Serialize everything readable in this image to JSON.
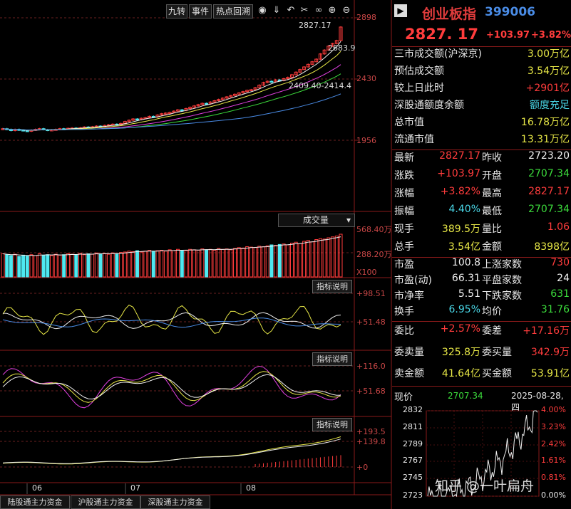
{
  "toolbar": {
    "buttons": [
      "九转",
      "事件",
      "热点回溯"
    ],
    "icons": [
      "eye-icon",
      "down-arrow-icon",
      "undo-icon",
      "scissors-icon",
      "infinity-icon",
      "zoom-in-icon",
      "zoom-out-icon"
    ]
  },
  "main_chart": {
    "price_ticks": [
      "2898",
      "2430",
      "1956"
    ],
    "high_label": "2827.17",
    "right_label": "2683.9",
    "low_label": "2409.40-2414.4"
  },
  "volume_panel": {
    "selector_label": "成交量",
    "ticks": [
      "568.40万",
      "288.20万"
    ],
    "unit": "X100"
  },
  "indicator1": {
    "button": "指标说明",
    "ticks": [
      "+98.51",
      "+51.48"
    ]
  },
  "indicator2": {
    "button": "指标说明",
    "ticks": [
      "+116.0",
      "+51.68"
    ]
  },
  "indicator3": {
    "button": "指标说明",
    "ticks": [
      "+193.5",
      "+139.8",
      "+0"
    ]
  },
  "months": [
    "06",
    "07",
    "08"
  ],
  "bottom_tabs": [
    "陆股通主力资金",
    "沪股通主力资金",
    "深股通主力资金"
  ],
  "chart_data": [
    {
      "type": "candlestick",
      "title": "",
      "ylim": [
        1956,
        2898
      ],
      "ticks": [
        2898,
        2430,
        1956
      ],
      "close": [
        2045,
        2040,
        2030,
        2040,
        2035,
        2030,
        2025,
        2035,
        2040,
        2045,
        2038,
        2032,
        2036,
        2040,
        2045,
        2042,
        2048,
        2050,
        2046,
        2052,
        2058,
        2055,
        2060,
        2065,
        2062,
        2070,
        2075,
        2080,
        2074,
        2085,
        2100,
        2110,
        2120,
        2115,
        2125,
        2130,
        2140,
        2135,
        2150,
        2160,
        2165,
        2170,
        2180,
        2190,
        2185,
        2200,
        2210,
        2220,
        2230,
        2240,
        2235,
        2250,
        2260,
        2270,
        2280,
        2290,
        2300,
        2310,
        2320,
        2330,
        2340,
        2345,
        2360,
        2380,
        2400,
        2410,
        2405,
        2420,
        2415,
        2430,
        2440,
        2460,
        2480,
        2500,
        2520,
        2540,
        2560,
        2580,
        2620,
        2650,
        2680,
        2700,
        2723,
        2827
      ],
      "high_value": 2827.17,
      "low_value": 2409.4
    },
    {
      "type": "bar",
      "title": "成交量",
      "ticks": [
        "568.40万",
        "288.20万"
      ],
      "unit": "X100",
      "values": [
        260,
        250,
        240,
        255,
        230,
        245,
        235,
        250,
        240,
        260,
        245,
        250,
        240,
        255,
        245,
        250,
        260,
        255,
        250,
        265,
        250,
        260,
        255,
        270,
        260,
        265,
        255,
        270,
        260,
        275,
        280,
        290,
        285,
        295,
        280,
        290,
        300,
        285,
        295,
        300,
        290,
        305,
        295,
        310,
        300,
        295,
        310,
        305,
        300,
        315,
        305,
        310,
        300,
        320,
        310,
        315,
        305,
        320,
        330,
        325,
        340,
        335,
        330,
        345,
        340,
        350,
        360,
        355,
        365,
        370,
        360,
        380,
        390,
        375,
        400,
        410,
        395,
        420,
        430,
        425,
        440,
        450,
        460,
        480
      ]
    }
  ],
  "header": {
    "name": "创业板指",
    "code": "399006"
  },
  "quote": {
    "price": "2827. 17",
    "change": "+103.97",
    "pct": "+3.82%"
  },
  "market": [
    {
      "label": "三市成交额(沪深京)",
      "value": "3.00万亿"
    },
    {
      "label": "预估成交额",
      "value": "3.54万亿"
    },
    {
      "label": "较上日此时",
      "value": "+2901亿"
    },
    {
      "label": "深股通额度余额",
      "value": "额度充足"
    },
    {
      "label": "总市值",
      "value": "16.78万亿"
    },
    {
      "label": "流通市值",
      "value": "13.31万亿"
    }
  ],
  "stats": [
    {
      "l1": "最新",
      "v1": "2827.17",
      "l2": "昨收",
      "v2": "2723.20"
    },
    {
      "l1": "涨跌",
      "v1": "+103.97",
      "l2": "开盘",
      "v2": "2707.34"
    },
    {
      "l1": "涨幅",
      "v1": "+3.82%",
      "l2": "最高",
      "v2": "2827.17"
    },
    {
      "l1": "振幅",
      "v1": "4.40%",
      "l2": "最低",
      "v2": "2707.34"
    },
    {
      "l1": "现手",
      "v1": "389.5万",
      "l2": "量比",
      "v2": "1.06"
    },
    {
      "l1": "总手",
      "v1": "3.54亿",
      "l2": "金额",
      "v2": "8398亿"
    }
  ],
  "valuation": [
    {
      "l1": "市盈",
      "v1": "100.8",
      "l2": "上涨家数",
      "v2": "730"
    },
    {
      "l1": "市盈(动)",
      "v1": "66.31",
      "l2": "平盘家数",
      "v2": "24"
    },
    {
      "l1": "市净率",
      "v1": "5.51",
      "l2": "下跌家数",
      "v2": "631"
    },
    {
      "l1": "换手",
      "v1": "6.95%",
      "l2": "均价",
      "v2": "31.76"
    }
  ],
  "orders": [
    {
      "l1": "委比",
      "v1": "+2.57%",
      "l2": "委差",
      "v2": "+17.16万"
    },
    {
      "l1": "委卖量",
      "v1": "325.8万",
      "l2": "委买量",
      "v2": "342.9万"
    },
    {
      "l1": "卖金额",
      "v1": "41.64亿",
      "l2": "买金额",
      "v2": "53.91亿"
    }
  ],
  "current": {
    "label": "现价",
    "value": "2707.34",
    "date": "2025-08-28,四"
  },
  "mini_chart": {
    "price_ticks": [
      "2832",
      "2811",
      "2789",
      "2767",
      "2745",
      "2723"
    ],
    "pct_ticks": [
      "4.00%",
      "3.23%",
      "2.42%",
      "1.61%",
      "0.81%",
      "0.00%"
    ]
  },
  "watermark": "知乎 @一叶扁舟",
  "colors": {
    "up": "#ff3c3c",
    "down": "#4ee8f0",
    "axis": "#8a1a1a",
    "bg": "#000000"
  }
}
